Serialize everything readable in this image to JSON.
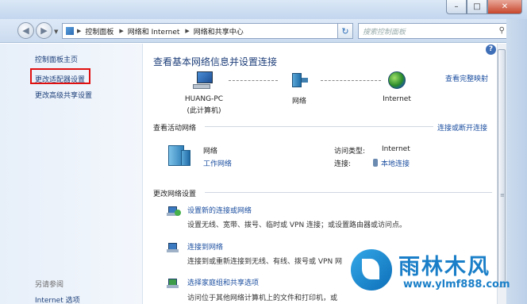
{
  "window": {
    "minimize": "–",
    "maximize": "□",
    "close": "✕"
  },
  "nav": {
    "back_glyph": "◀",
    "forward_glyph": "▶",
    "breadcrumb": [
      "控制面板",
      "网络和 Internet",
      "网络和共享中心"
    ],
    "refresh_glyph": "↻",
    "search_placeholder": "搜索控制面板"
  },
  "sidebar": {
    "items": [
      "控制面板主页",
      "更改适配器设置",
      "更改高级共享设置"
    ],
    "see_also_title": "另请参阅",
    "see_also_items": [
      "Internet 选项"
    ]
  },
  "main": {
    "heading": "查看基本网络信息并设置连接",
    "full_map_link": "查看完整映射",
    "nodes": [
      {
        "name": "HUANG-PC",
        "sub": "(此计算机)"
      },
      {
        "name": "网络",
        "sub": ""
      },
      {
        "name": "Internet",
        "sub": ""
      }
    ],
    "active_networks": {
      "title": "查看活动网络",
      "connect_link": "连接或断开连接",
      "network_name": "网络",
      "network_type": "工作网络",
      "access_type_label": "访问类型:",
      "access_type_value": "Internet",
      "connection_label": "连接:",
      "connection_value": "本地连接"
    },
    "change_settings": {
      "title": "更改网络设置",
      "tasks": [
        {
          "title": "设置新的连接或网络",
          "desc": "设置无线、宽带、拨号、临时或 VPN 连接；或设置路由器或访问点。"
        },
        {
          "title": "连接到网络",
          "desc": "连接到或重新连接到无线、有线、拨号或 VPN 网"
        },
        {
          "title": "选择家庭组和共享选项",
          "desc": "访问位于其他网络计算机上的文件和打印机，或"
        }
      ]
    }
  },
  "watermark": {
    "brand": "雨林木风",
    "url": "www.ylmf888.com"
  },
  "colors": {
    "link": "#1c4fa0",
    "heading": "#1e3f7a",
    "highlight_border": "#e01010",
    "brand": "#1a7fc8"
  }
}
